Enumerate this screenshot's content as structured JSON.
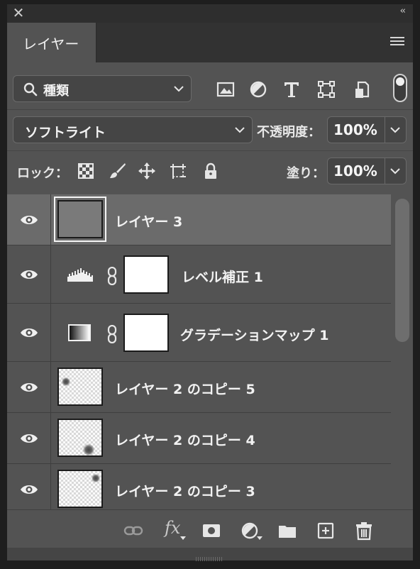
{
  "panel": {
    "title_tab": "レイヤー",
    "close_icon": "close-icon",
    "collapse_icon": "double-chevron-left-icon",
    "menu_icon": "hamburger-menu-icon"
  },
  "filter": {
    "selected": "種類",
    "icons": [
      "image-filter-icon",
      "adjustment-filter-icon",
      "type-filter-icon",
      "shape-filter-icon",
      "smart-object-filter-icon"
    ]
  },
  "blend": {
    "mode": "ソフトライト",
    "opacity_label": "不透明度：",
    "opacity_value": "100%"
  },
  "lock": {
    "label": "ロック：",
    "fill_label": "塗り：",
    "fill_value": "100%",
    "icons": [
      "lock-transparent-pixels-icon",
      "lock-image-pixels-icon",
      "lock-position-icon",
      "lock-artboard-icon",
      "lock-all-icon"
    ]
  },
  "layers": [
    {
      "name": "レイヤー 3",
      "kind": "gray",
      "selected": true
    },
    {
      "name": "レベル補正 1",
      "kind": "levels-adjustment"
    },
    {
      "name": "グラデーションマップ 1",
      "kind": "gradient-map-adjustment"
    },
    {
      "name": "レイヤー 2 のコピー 5",
      "kind": "checker"
    },
    {
      "name": "レイヤー 2 のコピー 4",
      "kind": "checker"
    },
    {
      "name": "レイヤー 2 のコピー 3",
      "kind": "checker"
    }
  ],
  "bottom_toolbar": {
    "fx_label": "fx",
    "icons": [
      "link-layers-icon",
      "layer-style-icon",
      "add-mask-icon",
      "new-adjustment-icon",
      "new-group-icon",
      "new-layer-icon",
      "delete-layer-icon"
    ]
  },
  "colors": {
    "panel_bg": "#535353",
    "selected_row": "#6b6b6b",
    "chrome_dark": "#1e1e1e"
  }
}
